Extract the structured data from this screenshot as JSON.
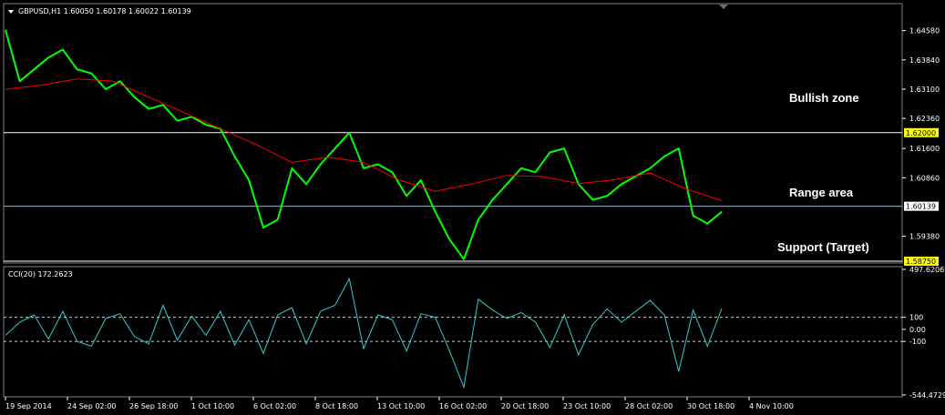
{
  "colors": {
    "background": "#000000",
    "price": "#00ff00",
    "ma": "#ff0000",
    "level_line": "#ffffff",
    "level_badge": "#ffff00",
    "cci": "#33cccc",
    "frame": "#808080"
  },
  "price_panel": {
    "header": "GBPUSD,H1  1.60050 1.60178 1.60022 1.60139",
    "menu_icon": "triangle-down-icon"
  },
  "cci_panel": {
    "header": "CCI(20) 172.2623"
  },
  "annotations": [
    {
      "text": "Bullish zone"
    },
    {
      "text": "Range area"
    },
    {
      "text": "Support (Target)"
    }
  ],
  "chart_data": [
    {
      "type": "line",
      "ylim": [
        1.5875,
        1.6494
      ],
      "y_ticks": [
        "1.64580",
        "1.63840",
        "1.63100",
        "1.62360",
        "1.61600",
        "1.60860",
        "1.59380"
      ],
      "y_tick_values": [
        1.6458,
        1.6384,
        1.631,
        1.6236,
        1.616,
        1.6086,
        1.5938
      ],
      "levels": [
        {
          "label": "1.62000",
          "value": 1.62,
          "color": "#ffffff",
          "badge": "yellow"
        },
        {
          "label": "1.60139",
          "value": 1.60139,
          "color": "#9fb7c7",
          "badge": "white"
        },
        {
          "label": "1.58750",
          "value": 1.5875,
          "color": "#ffffff",
          "badge": "yellow"
        }
      ],
      "x_labels": [
        "19 Sep 2014",
        "24 Sep 02:00",
        "26 Sep 18:00",
        "1 Oct 10:00",
        "6 Oct 02:00",
        "8 Oct 18:00",
        "13 Oct 10:00",
        "16 Oct 02:00",
        "20 Oct 18:00",
        "23 Oct 10:00",
        "28 Oct 02:00",
        "30 Oct 18:00",
        "4 Nov 10:00"
      ],
      "series": [
        {
          "role": "price",
          "x": [
            0,
            2,
            4,
            6,
            8,
            10,
            12,
            14,
            16,
            18,
            20,
            22,
            24,
            26,
            28,
            30,
            32,
            34,
            36,
            38,
            40,
            42,
            44,
            46,
            48,
            50,
            52,
            54,
            56,
            58,
            60,
            62,
            64,
            66,
            68,
            70,
            72,
            74,
            76,
            78,
            80,
            82,
            84,
            86,
            88,
            90,
            92,
            94,
            96,
            98,
            100
          ],
          "values": [
            1.646,
            1.633,
            1.636,
            1.639,
            1.641,
            1.636,
            1.635,
            1.631,
            1.633,
            1.629,
            1.626,
            1.627,
            1.623,
            1.624,
            1.622,
            1.621,
            1.614,
            1.608,
            1.596,
            1.598,
            1.611,
            1.607,
            1.612,
            1.616,
            1.62,
            1.611,
            1.612,
            1.61,
            1.604,
            1.608,
            1.6,
            1.593,
            1.588,
            1.598,
            1.603,
            1.607,
            1.611,
            1.61,
            1.615,
            1.616,
            1.607,
            1.603,
            1.604,
            1.607,
            1.609,
            1.611,
            1.614,
            1.616,
            1.599,
            1.597,
            1.6
          ]
        },
        {
          "role": "moving-average",
          "x": [
            0,
            5,
            10,
            15,
            20,
            25,
            30,
            35,
            40,
            45,
            50,
            55,
            60,
            65,
            70,
            75,
            80,
            85,
            90,
            95,
            100
          ],
          "values": [
            1.631,
            1.632,
            1.6336,
            1.633,
            1.629,
            1.625,
            1.621,
            1.617,
            1.6125,
            1.6138,
            1.6125,
            1.608,
            1.6052,
            1.607,
            1.6092,
            1.6089,
            1.6071,
            1.6081,
            1.6098,
            1.6058,
            1.6028
          ]
        }
      ]
    },
    {
      "type": "line",
      "ylim": [
        -544.4729,
        497.6206
      ],
      "y_ticks": [
        "497.6206",
        "100",
        "0.00",
        "-100",
        "-544.4729"
      ],
      "y_tick_values": [
        497.6206,
        100,
        0,
        -100,
        -544.4729
      ],
      "levels": [
        {
          "label": "100",
          "value": 100
        },
        {
          "label": "-100",
          "value": -100
        }
      ],
      "series": [
        {
          "role": "cci",
          "x": [
            0,
            2,
            4,
            6,
            8,
            10,
            12,
            14,
            16,
            18,
            20,
            22,
            24,
            26,
            28,
            30,
            32,
            34,
            36,
            38,
            40,
            42,
            44,
            46,
            48,
            50,
            52,
            54,
            56,
            58,
            60,
            62,
            64,
            66,
            68,
            70,
            72,
            74,
            76,
            78,
            80,
            82,
            84,
            86,
            88,
            90,
            92,
            94,
            96,
            98,
            100
          ],
          "values": [
            -50,
            60,
            120,
            -80,
            150,
            -100,
            -140,
            90,
            130,
            -60,
            -120,
            200,
            -90,
            110,
            -50,
            150,
            -130,
            80,
            -200,
            120,
            180,
            -120,
            150,
            200,
            420,
            -160,
            120,
            80,
            -180,
            130,
            100,
            -180,
            -480,
            250,
            160,
            90,
            140,
            60,
            -150,
            120,
            -210,
            40,
            170,
            60,
            150,
            240,
            120,
            -350,
            160,
            -140,
            172
          ]
        }
      ]
    }
  ]
}
